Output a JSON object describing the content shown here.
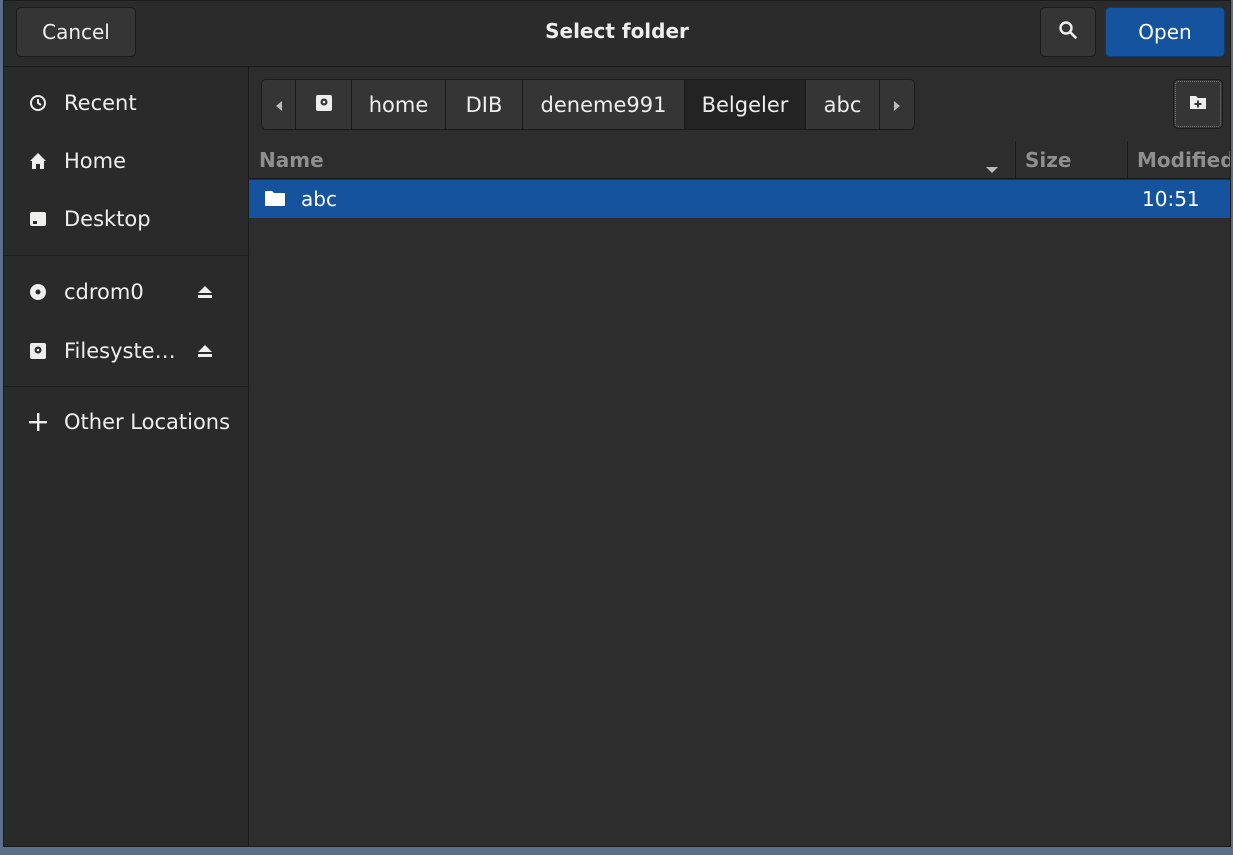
{
  "header": {
    "title": "Select folder",
    "cancel_label": "Cancel",
    "open_label": "Open"
  },
  "sidebar": {
    "items": [
      {
        "label": "Recent",
        "icon": "clock-icon"
      },
      {
        "label": "Home",
        "icon": "home-icon"
      },
      {
        "label": "Desktop",
        "icon": "desktop-icon"
      },
      {
        "label": "cdrom0",
        "icon": "disc-icon"
      },
      {
        "label": "Filesyste…",
        "icon": "drive-icon"
      },
      {
        "label": "Other Locations",
        "icon": "plus-icon"
      }
    ]
  },
  "pathbar": {
    "crumbs": [
      "home",
      "DIB",
      "deneme991",
      "Belgeler",
      "abc"
    ],
    "active": "Belgeler"
  },
  "list": {
    "columns": {
      "name": "Name",
      "size": "Size",
      "modified": "Modified"
    },
    "rows": [
      {
        "name": "abc",
        "size": "",
        "modified": "10:51",
        "selected": true
      }
    ]
  },
  "colors": {
    "accent": "#15539e",
    "background": "#2d2d2d",
    "sidebar": "#2a2a2a"
  }
}
